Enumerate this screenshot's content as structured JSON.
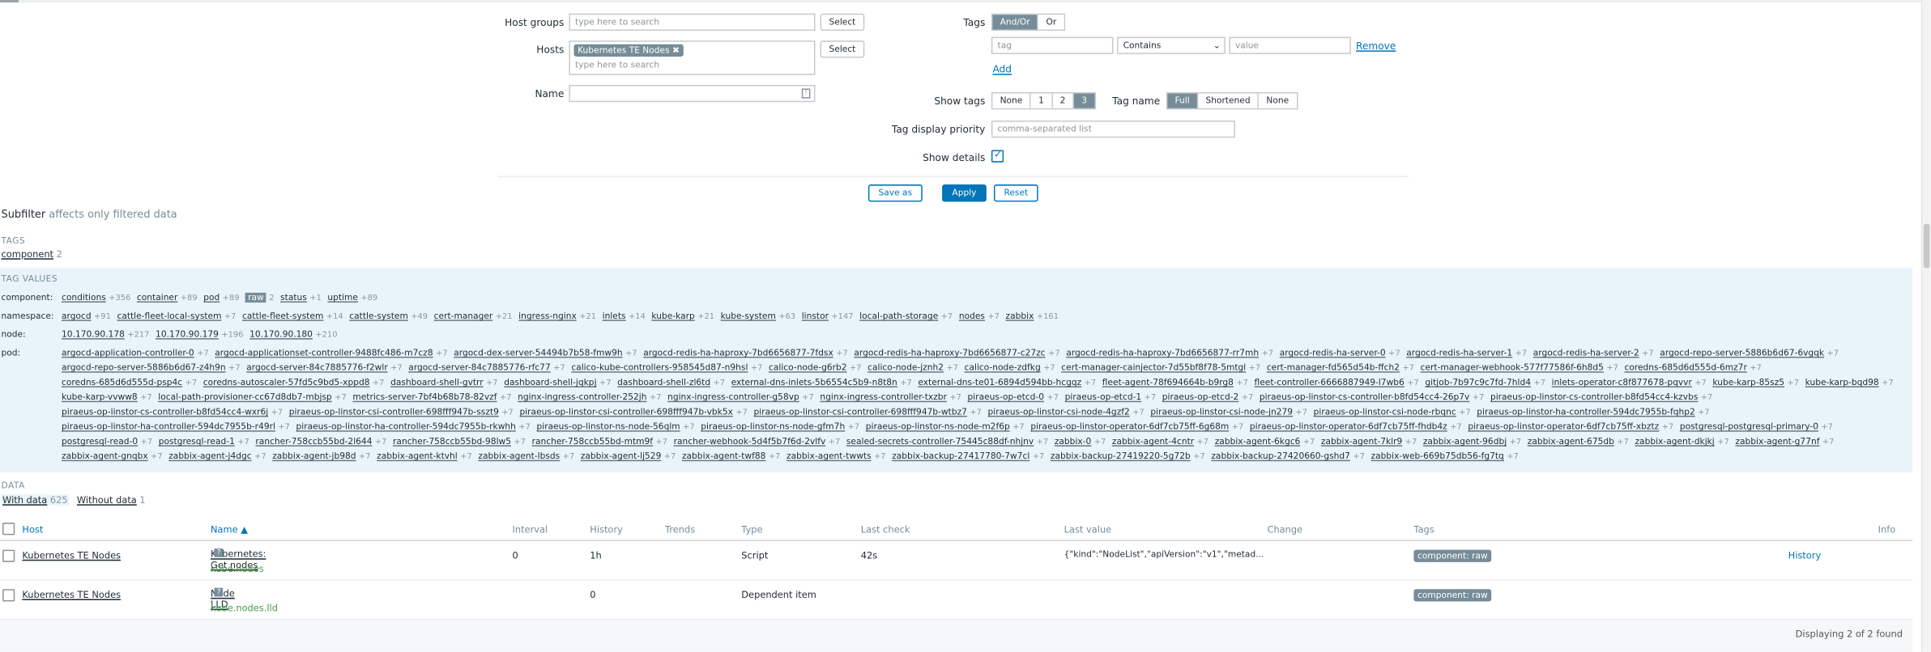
{
  "filter": {
    "host_groups_label": "Host groups",
    "host_groups_placeholder": "type here to search",
    "select": "Select",
    "hosts_label": "Hosts",
    "hosts_chip": "Kubernetes TE Nodes",
    "hosts_placeholder": "type here to search",
    "name_label": "Name",
    "tags_label": "Tags",
    "tags_andor": "And/Or",
    "tags_or": "Or",
    "tag_placeholder": "tag",
    "contains": "Contains",
    "value_placeholder": "value",
    "remove": "Remove",
    "add": "Add",
    "show_tags_label": "Show tags",
    "show_tags": [
      "None",
      "1",
      "2",
      "3"
    ],
    "tag_name_label": "Tag name",
    "tag_name": [
      "Full",
      "Shortened",
      "None"
    ],
    "tag_priority_label": "Tag display priority",
    "tag_priority_placeholder": "comma-separated list",
    "show_details_label": "Show details",
    "save_as": "Save as",
    "apply": "Apply",
    "reset": "Reset"
  },
  "subfilter": {
    "title": "Subfilter",
    "note": "affects only filtered data",
    "tags_header": "TAGS",
    "tags_item": "component",
    "tags_count": "2",
    "tag_values_header": "TAG VALUES",
    "component_label": "component:",
    "component": [
      [
        "conditions",
        "+356"
      ],
      [
        "container",
        "+89"
      ],
      [
        "pod",
        "+89"
      ],
      [
        "raw",
        "2"
      ],
      [
        "status",
        "+1"
      ],
      [
        "uptime",
        "+89"
      ]
    ],
    "namespace_label": "namespace:",
    "namespace": [
      [
        "argocd",
        "+91"
      ],
      [
        "cattle-fleet-local-system",
        "+7"
      ],
      [
        "cattle-fleet-system",
        "+14"
      ],
      [
        "cattle-system",
        "+49"
      ],
      [
        "cert-manager",
        "+21"
      ],
      [
        "ingress-nginx",
        "+21"
      ],
      [
        "inlets",
        "+14"
      ],
      [
        "kube-karp",
        "+21"
      ],
      [
        "kube-system",
        "+63"
      ],
      [
        "linstor",
        "+147"
      ],
      [
        "local-path-storage",
        "+7"
      ],
      [
        "nodes",
        "+7"
      ],
      [
        "zabbix",
        "+161"
      ]
    ],
    "node_label": "node:",
    "node": [
      [
        "10.170.90.178",
        "+217"
      ],
      [
        "10.170.90.179",
        "+196"
      ],
      [
        "10.170.90.180",
        "+210"
      ]
    ],
    "pod_label": "pod:",
    "pod": [
      [
        "argocd-application-controller-0",
        "+7"
      ],
      [
        "argocd-applicationset-controller-9488fc486-m7cz8",
        "+7"
      ],
      [
        "argocd-dex-server-54494b7b58-fmw9h",
        "+7"
      ],
      [
        "argocd-redis-ha-haproxy-7bd6656877-7fdsx",
        "+7"
      ],
      [
        "argocd-redis-ha-haproxy-7bd6656877-c27zc",
        "+7"
      ],
      [
        "argocd-redis-ha-haproxy-7bd6656877-rr7mh",
        "+7"
      ],
      [
        "argocd-redis-ha-server-0",
        "+7"
      ],
      [
        "argocd-redis-ha-server-1",
        "+7"
      ],
      [
        "argocd-redis-ha-server-2",
        "+7"
      ],
      [
        "argocd-repo-server-5886b6d67-6vgqk",
        "+7"
      ],
      [
        "argocd-repo-server-5886b6d67-z4h9n",
        "+7"
      ],
      [
        "argocd-server-84c7885776-f2wlr",
        "+7"
      ],
      [
        "argocd-server-84c7885776-rfc77",
        "+7"
      ],
      [
        "calico-kube-controllers-958545d87-n9hsl",
        "+7"
      ],
      [
        "calico-node-g6rb2",
        "+7"
      ],
      [
        "calico-node-jznh2",
        "+7"
      ],
      [
        "calico-node-zdfkg",
        "+7"
      ],
      [
        "cert-manager-cainjector-7d55bf8f78-5mtgl",
        "+7"
      ],
      [
        "cert-manager-fd565d54b-ffch2",
        "+7"
      ],
      [
        "cert-manager-webhook-577f77586f-6h8d5",
        "+7"
      ],
      [
        "coredns-685d6d555d-6mz7r",
        "+7"
      ],
      [
        "coredns-685d6d555d-psp4c",
        "+7"
      ],
      [
        "coredns-autoscaler-57fd5c9bd5-xppd8",
        "+7"
      ],
      [
        "dashboard-shell-gvtrr",
        "+7"
      ],
      [
        "dashboard-shell-jqkpj",
        "+7"
      ],
      [
        "dashboard-shell-zl6td",
        "+7"
      ],
      [
        "external-dns-inlets-5b6554c5b9-n8t8n",
        "+7"
      ],
      [
        "external-dns-te01-6894d594bb-hcgqz",
        "+7"
      ],
      [
        "fleet-agent-78f694664b-b9rg8",
        "+7"
      ],
      [
        "fleet-controller-6666887949-l7wb6",
        "+7"
      ],
      [
        "gitjob-7b97c9c7fd-7hld4",
        "+7"
      ],
      [
        "inlets-operator-c8f877678-pqvvr",
        "+7"
      ],
      [
        "kube-karp-85sz5",
        "+7"
      ],
      [
        "kube-karp-bqd98",
        "+7"
      ],
      [
        "kube-karp-vvww8",
        "+7"
      ],
      [
        "local-path-provisioner-cc67d8db7-mbjsp",
        "+7"
      ],
      [
        "metrics-server-7bf4b68b78-82vzf",
        "+7"
      ],
      [
        "nginx-ingress-controller-252jh",
        "+7"
      ],
      [
        "nginx-ingress-controller-g58vp",
        "+7"
      ],
      [
        "nginx-ingress-controller-txzbr",
        "+7"
      ],
      [
        "piraeus-op-etcd-0",
        "+7"
      ],
      [
        "piraeus-op-etcd-1",
        "+7"
      ],
      [
        "piraeus-op-etcd-2",
        "+7"
      ],
      [
        "piraeus-op-linstor-cs-controller-b8fd54cc4-26p7v",
        "+7"
      ],
      [
        "piraeus-op-linstor-cs-controller-b8fd54cc4-kzvbs",
        "+7"
      ],
      [
        "piraeus-op-linstor-cs-controller-b8fd54cc4-wxr6j",
        "+7"
      ],
      [
        "piraeus-op-linstor-csi-controller-698fff947b-sszt9",
        "+7"
      ],
      [
        "piraeus-op-linstor-csi-controller-698fff947b-vbk5x",
        "+7"
      ],
      [
        "piraeus-op-linstor-csi-controller-698fff947b-wtbz7",
        "+7"
      ],
      [
        "piraeus-op-linstor-csi-node-4gzf2",
        "+7"
      ],
      [
        "piraeus-op-linstor-csi-node-jn279",
        "+7"
      ],
      [
        "piraeus-op-linstor-csi-node-rbqnc",
        "+7"
      ],
      [
        "piraeus-op-linstor-ha-controller-594dc7955b-fqhp2",
        "+7"
      ],
      [
        "piraeus-op-linstor-ha-controller-594dc7955b-r49rl",
        "+7"
      ],
      [
        "piraeus-op-linstor-ha-controller-594dc7955b-rkwhh",
        "+7"
      ],
      [
        "piraeus-op-linstor-ns-node-56qlm",
        "+7"
      ],
      [
        "piraeus-op-linstor-ns-node-gfm7h",
        "+7"
      ],
      [
        "piraeus-op-linstor-ns-node-m2f6p",
        "+7"
      ],
      [
        "piraeus-op-linstor-operator-6df7cb75ff-6g68m",
        "+7"
      ],
      [
        "piraeus-op-linstor-operator-6df7cb75ff-fhdb4z",
        "+7"
      ],
      [
        "piraeus-op-linstor-operator-6df7cb75ff-xbztz",
        "+7"
      ],
      [
        "postgresql-postgresql-primary-0",
        "+7"
      ],
      [
        "postgresql-read-0",
        "+7"
      ],
      [
        "postgresql-read-1",
        "+7"
      ],
      [
        "rancher-758ccb55bd-2l644",
        "+7"
      ],
      [
        "rancher-758ccb55bd-98lw5",
        "+7"
      ],
      [
        "rancher-758ccb55bd-mtm9f",
        "+7"
      ],
      [
        "rancher-webhook-5d4f5b7f6d-2vlfv",
        "+7"
      ],
      [
        "sealed-secrets-controller-75445c88df-nhjnv",
        "+7"
      ],
      [
        "zabbix-0",
        "+7"
      ],
      [
        "zabbix-agent-4cntr",
        "+7"
      ],
      [
        "zabbix-agent-6kgc6",
        "+7"
      ],
      [
        "zabbix-agent-7klr9",
        "+7"
      ],
      [
        "zabbix-agent-96dbj",
        "+7"
      ],
      [
        "zabbix-agent-675db",
        "+7"
      ],
      [
        "zabbix-agent-dkjkj",
        "+7"
      ],
      [
        "zabbix-agent-g77nf",
        "+7"
      ],
      [
        "zabbix-agent-gnqbx",
        "+7"
      ],
      [
        "zabbix-agent-j4dgc",
        "+7"
      ],
      [
        "zabbix-agent-jb98d",
        "+7"
      ],
      [
        "zabbix-agent-ktvhl",
        "+7"
      ],
      [
        "zabbix-agent-lbsds",
        "+7"
      ],
      [
        "zabbix-agent-lj529",
        "+7"
      ],
      [
        "zabbix-agent-twf88",
        "+7"
      ],
      [
        "zabbix-agent-twwts",
        "+7"
      ],
      [
        "zabbix-backup-27417780-7w7cl",
        "+7"
      ],
      [
        "zabbix-backup-27419220-5g72b",
        "+7"
      ],
      [
        "zabbix-backup-27420660-gshd7",
        "+7"
      ],
      [
        "zabbix-web-669b75db56-fg7tq",
        "+7"
      ]
    ],
    "data_header": "DATA",
    "with_data": "With data",
    "with_data_count": "625",
    "without_data": "Without data",
    "without_data_count": "1"
  },
  "table": {
    "headers": {
      "host": "Host",
      "name": "Name ▲",
      "interval": "Interval",
      "history": "History",
      "trends": "Trends",
      "type": "Type",
      "last_check": "Last check",
      "last_value": "Last value",
      "change": "Change",
      "tags": "Tags",
      "info": "Info"
    },
    "rows": [
      {
        "host": "Kubernetes TE Nodes",
        "name": "Kubernetes: Get nodes",
        "key": "kube.nodes",
        "interval": "0",
        "history": "1h",
        "type": "Script",
        "last_check": "42s",
        "last_value": "{\"kind\":\"NodeList\",\"apiVersion\":\"v1\",\"metad...",
        "tag": "component: raw",
        "action": "History"
      },
      {
        "host": "Kubernetes TE Nodes",
        "name": "Node LLD",
        "key": "kube.nodes.lld",
        "interval": "",
        "history": "0",
        "type": "Dependent item",
        "last_check": "",
        "last_value": "",
        "tag": "component: raw",
        "action": ""
      }
    ],
    "footer": "Displaying 2 of 2 found"
  }
}
